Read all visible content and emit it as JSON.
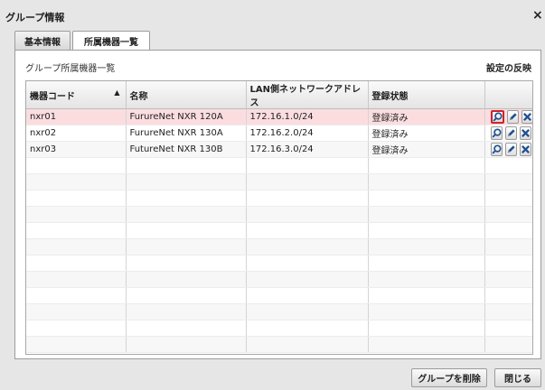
{
  "dialog": {
    "title": "グループ情報",
    "close": "×"
  },
  "tabs": [
    {
      "label": "基本情報"
    },
    {
      "label": "所属機器一覧"
    }
  ],
  "panel": {
    "title": "グループ所属機器一覧",
    "apply_label": "設定の反映"
  },
  "table": {
    "headers": [
      "機器コード",
      "名称",
      "LAN側ネットワークアドレス",
      "登録状態"
    ],
    "sort_indicator": "▲",
    "rows": [
      [
        "nxr01",
        "FurureNet NXR 120A",
        "172.16.1.0/24",
        "登録済み"
      ],
      [
        "nxr02",
        "FurureNet NXR 130A",
        "172.16.2.0/24",
        "登録済み"
      ],
      [
        "nxr03",
        "FutureNet NXR 130B",
        "172.16.3.0/24",
        "登録済み"
      ]
    ],
    "row_actions": [
      "search-icon",
      "pencil-icon",
      "delete-icon"
    ]
  },
  "footer": {
    "delete_label": "グループを削除",
    "close_label": "閉じる"
  },
  "colors": {
    "selected_row": "#fbdde0",
    "focus": "#d0212b",
    "icon_blue": "#1f4f8f"
  }
}
